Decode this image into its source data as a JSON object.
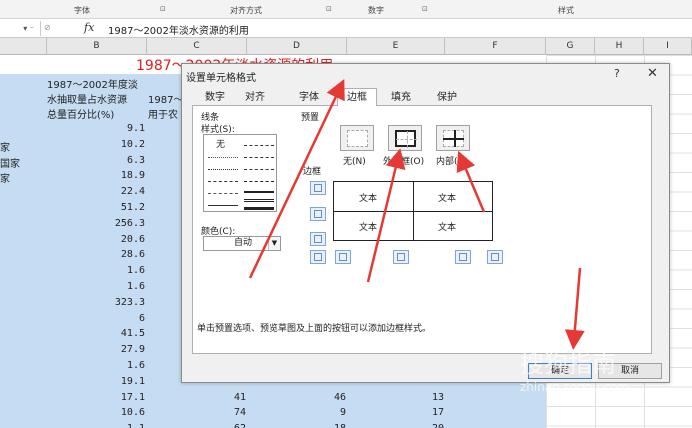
{
  "ribbon": {
    "groups": [
      "字体",
      "对齐方式",
      "数字",
      "样式"
    ],
    "launcher": "⊡"
  },
  "formula_bar": {
    "name_box": "▾ ⁻",
    "cancel": "⊘",
    "fx": "fx",
    "value": "1987～2002年淡水资源的利用"
  },
  "columns": [
    "B",
    "C",
    "D",
    "E",
    "F",
    "G",
    "H",
    "I"
  ],
  "sheet": {
    "title": "1987～2002年淡水资源的利用",
    "header_b": [
      "1987～2002年度淡",
      "水抽取量占水资源",
      "总量百分比(%)"
    ],
    "header_c": [
      "1987～",
      "用于农"
    ],
    "row_a": [
      "家",
      "国家",
      "家"
    ],
    "rows": [
      {
        "b": "9.1",
        "c": "",
        "d": "",
        "e": ""
      },
      {
        "b": "10.2",
        "c": "",
        "d": "",
        "e": ""
      },
      {
        "b": "6.3",
        "c": "",
        "d": "",
        "e": ""
      },
      {
        "b": "18.9",
        "c": "",
        "d": "",
        "e": ""
      },
      {
        "b": "22.4",
        "c": "",
        "d": "",
        "e": ""
      },
      {
        "b": "51.2",
        "c": "",
        "d": "",
        "e": ""
      },
      {
        "b": "256.3",
        "c": "",
        "d": "",
        "e": ""
      },
      {
        "b": "20.6",
        "c": "",
        "d": "",
        "e": ""
      },
      {
        "b": "28.6",
        "c": "",
        "d": "",
        "e": ""
      },
      {
        "b": "1.6",
        "c": "",
        "d": "",
        "e": ""
      },
      {
        "b": "1.6",
        "c": "",
        "d": "",
        "e": ""
      },
      {
        "b": "323.3",
        "c": "",
        "d": "",
        "e": ""
      },
      {
        "b": "6",
        "c": "",
        "d": "",
        "e": ""
      },
      {
        "b": "41.5",
        "c": "",
        "d": "",
        "e": ""
      },
      {
        "b": "27.9",
        "c": "",
        "d": "",
        "e": ""
      },
      {
        "b": "1.6",
        "c": "",
        "d": "",
        "e": ""
      },
      {
        "b": "19.1",
        "c": "",
        "d": "",
        "e": ""
      },
      {
        "b": "17.1",
        "c": "41",
        "d": "46",
        "e": "13"
      },
      {
        "b": "10.6",
        "c": "74",
        "d": "9",
        "e": "17"
      },
      {
        "b": "1.1",
        "c": "62",
        "d": "18",
        "e": "20"
      }
    ]
  },
  "dialog": {
    "title": "设置单元格格式",
    "help": "?",
    "close": "✕",
    "tabs": [
      "数字",
      "对齐",
      "字体",
      "边框",
      "填充",
      "保护"
    ],
    "active_tab": "边框",
    "line_section": "线条",
    "style_label": "样式(S):",
    "style_none": "无",
    "color_label": "颜色(C):",
    "color_value": "自动",
    "preset_section": "预置",
    "presets": [
      "无(N)",
      "外边框(O)",
      "内部(I)"
    ],
    "border_section": "边框",
    "preview_text": "文本",
    "hint": "单击预置选项、预览草图及上面的按钮可以添加边框样式。",
    "ok": "确定",
    "cancel": "取消"
  },
  "watermark": "搜狗指南",
  "watermark_sub": "zhinan.sogou.com",
  "colors": {
    "selection": "#c6dcf2",
    "title_red": "#e02020",
    "arrow_red": "#e53935"
  }
}
